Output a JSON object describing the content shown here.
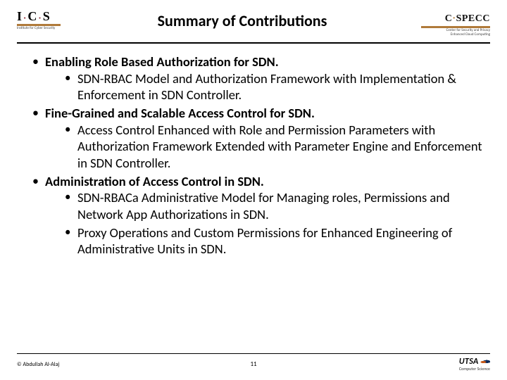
{
  "header": {
    "left": {
      "mark_segments": {
        "i": "I",
        "c": "C",
        "s": "S"
      },
      "sub": "Institute for Cyber Security"
    },
    "title": "Summary of Contributions",
    "right": {
      "mark_c": "C",
      "mark_dash": "·",
      "mark_specc": "SPECC",
      "sub1": "Center for Security and Privacy",
      "sub2": "Enhanced Cloud Computing"
    }
  },
  "bullets": [
    {
      "head": "Enabling Role Based Authorization for SDN.",
      "subs": [
        "SDN-RBAC Model and Authorization Framework with Implementation & Enforcement in SDN Controller."
      ]
    },
    {
      "head": "Fine-Grained and Scalable Access Control for SDN.",
      "subs": [
        "Access Control Enhanced with Role and Permission Parameters with Authorization Framework Extended with Parameter Engine and Enforcement in SDN Controller."
      ]
    },
    {
      "head": "Administration of Access Control in SDN.",
      "subs": [
        "SDN-RBACa Administrative Model for Managing roles, Permissions and Network App Authorizations in SDN.",
        "Proxy Operations and Custom Permissions for Enhanced Engineering of Administrative Units in SDN."
      ]
    }
  ],
  "footer": {
    "left": "© Abdullah Al-Alaj",
    "page": "11",
    "utsa": "UTSA",
    "dept": "Computer Science"
  }
}
